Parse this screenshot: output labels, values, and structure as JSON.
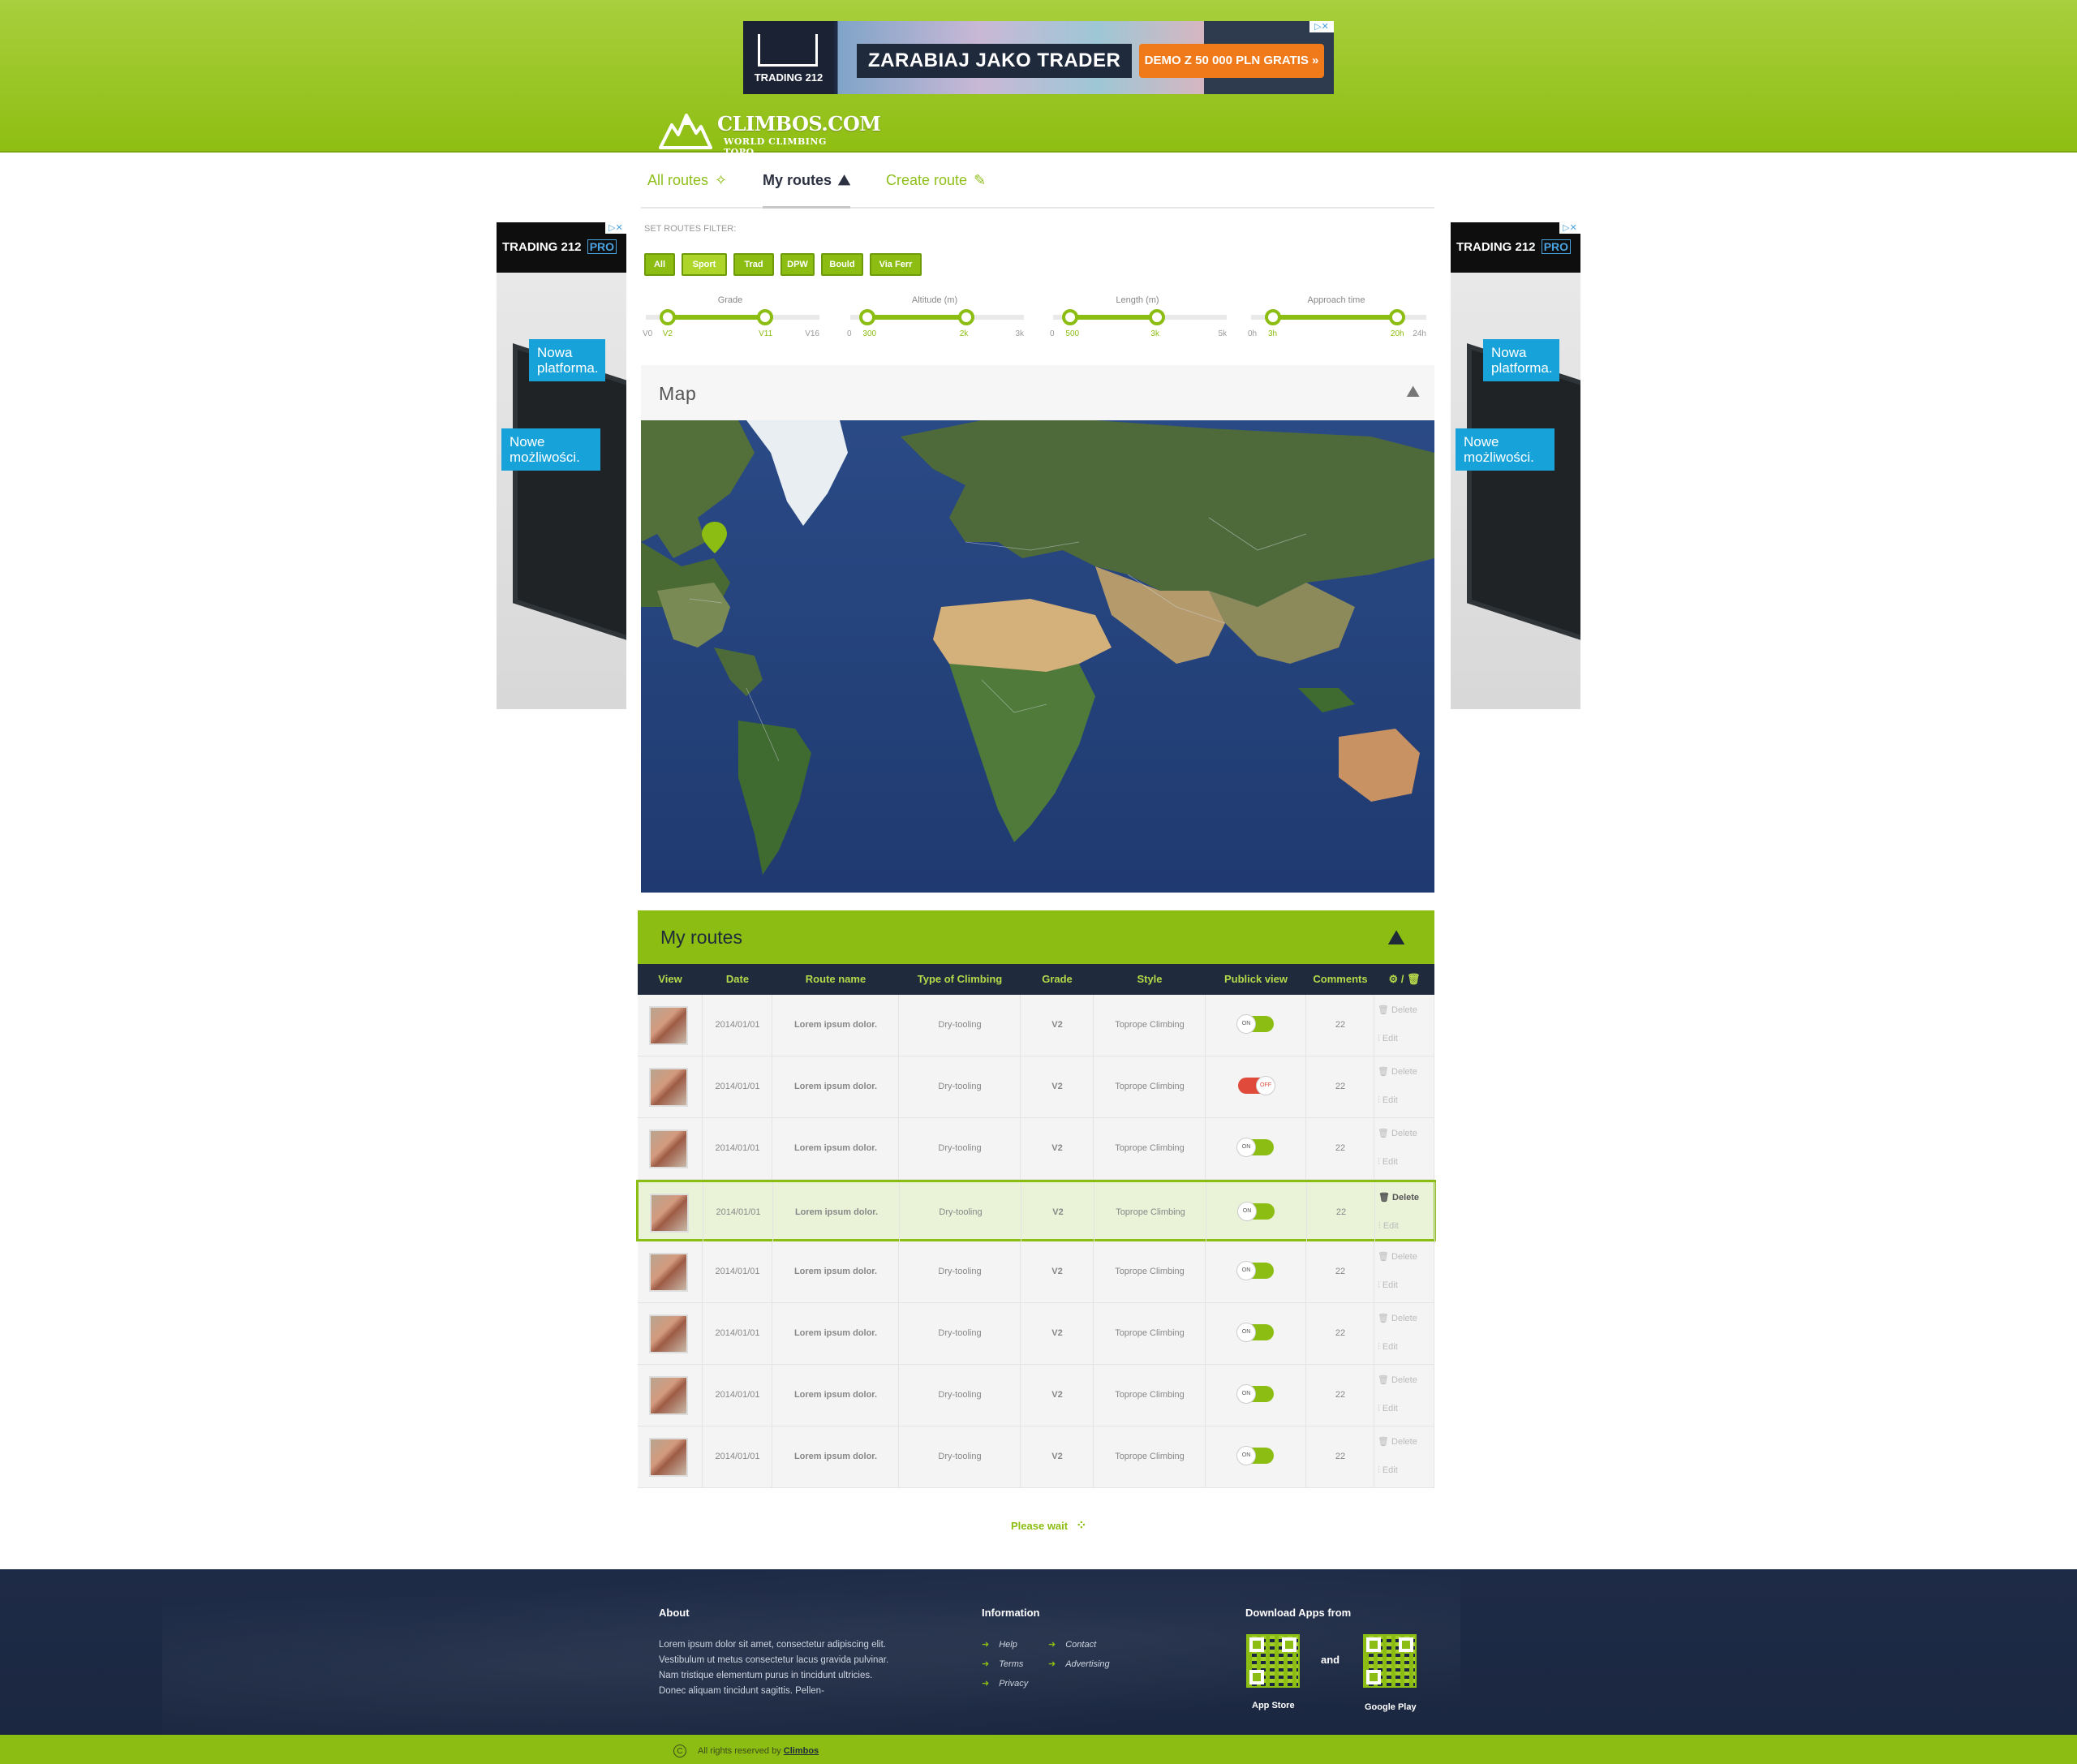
{
  "top_ad": {
    "brand": "TRADING 212",
    "headline": "ZARABIAJ JAKO TRADER",
    "cta": "DEMO Z 50 000 PLN GRATIS »",
    "close": "▷✕"
  },
  "logo": {
    "name": "CLIMBOS.COM",
    "tagline": "WORLD CLIMBING TOPO"
  },
  "tabs": [
    {
      "label": "All routes",
      "icon": "compass-icon",
      "glyph": "✧"
    },
    {
      "label": "My routes",
      "icon": "climber-icon",
      "glyph": "⛰"
    },
    {
      "label": "Create route",
      "icon": "add-route-icon",
      "glyph": "✎"
    }
  ],
  "side_ad": {
    "brand": "TRADING 212",
    "pro": "PRO",
    "bubble1": "Nowa platforma.",
    "bubble2": "Nowe możliwości.",
    "close": "▷✕"
  },
  "filter": {
    "title": "SET ROUTES FILTER:",
    "buttons": [
      "All",
      "Sport",
      "Trad",
      "DPW",
      "Bould",
      "Via Ferr"
    ],
    "active": "Sport",
    "sliders": [
      {
        "title": "Grade",
        "min": "V0",
        "low": "V2",
        "high": "V11",
        "max": "V16",
        "low_frac": 0.125,
        "high_frac": 0.6875
      },
      {
        "title": "Altitude (m)",
        "min": "0",
        "low": "300",
        "high": "2k",
        "max": "3k",
        "low_frac": 0.1,
        "high_frac": 0.667
      },
      {
        "title": "Length (m)",
        "min": "0",
        "low": "500",
        "high": "3k",
        "max": "5k",
        "low_frac": 0.1,
        "high_frac": 0.6
      },
      {
        "title": "Approach time",
        "min": "0h",
        "low": "3h",
        "high": "20h",
        "max": "24h",
        "low_frac": 0.125,
        "high_frac": 0.833
      }
    ]
  },
  "map": {
    "title": "Map",
    "icon": "map-icon"
  },
  "routes": {
    "title": "My routes",
    "columns": [
      "View",
      "Date",
      "Route name",
      "Type of Climbing",
      "Grade",
      "Style",
      "Publick view",
      "Comments",
      "⚙ / 🗑"
    ],
    "rows": [
      {
        "date": "2014/01/01",
        "name": "Lorem ipsum dolor.",
        "type": "Dry-tooling",
        "grade": "V2",
        "style": "Toprope Climbing",
        "public": "ON",
        "comments": "22",
        "delete": "Delete",
        "edit": "Edit"
      },
      {
        "date": "2014/01/01",
        "name": "Lorem ipsum dolor.",
        "type": "Dry-tooling",
        "grade": "V2",
        "style": "Toprope Climbing",
        "public": "OFF",
        "comments": "22",
        "delete": "Delete",
        "edit": "Edit"
      },
      {
        "date": "2014/01/01",
        "name": "Lorem ipsum dolor.",
        "type": "Dry-tooling",
        "grade": "V2",
        "style": "Toprope Climbing",
        "public": "ON",
        "comments": "22",
        "delete": "Delete",
        "edit": "Edit"
      },
      {
        "date": "2014/01/01",
        "name": "Lorem ipsum dolor.",
        "type": "Dry-tooling",
        "grade": "V2",
        "style": "Toprope Climbing",
        "public": "ON",
        "comments": "22",
        "delete": "Delete",
        "edit": "Edit"
      },
      {
        "date": "2014/01/01",
        "name": "Lorem ipsum dolor.",
        "type": "Dry-tooling",
        "grade": "V2",
        "style": "Toprope Climbing",
        "public": "ON",
        "comments": "22",
        "delete": "Delete",
        "edit": "Edit"
      },
      {
        "date": "2014/01/01",
        "name": "Lorem ipsum dolor.",
        "type": "Dry-tooling",
        "grade": "V2",
        "style": "Toprope Climbing",
        "public": "ON",
        "comments": "22",
        "delete": "Delete",
        "edit": "Edit"
      },
      {
        "date": "2014/01/01",
        "name": "Lorem ipsum dolor.",
        "type": "Dry-tooling",
        "grade": "V2",
        "style": "Toprope Climbing",
        "public": "ON",
        "comments": "22",
        "delete": "Delete",
        "edit": "Edit"
      },
      {
        "date": "2014/01/01",
        "name": "Lorem ipsum dolor.",
        "type": "Dry-tooling",
        "grade": "V2",
        "style": "Toprope Climbing",
        "public": "ON",
        "comments": "22",
        "delete": "Delete",
        "edit": "Edit"
      }
    ],
    "selected_row": 3
  },
  "loading": {
    "text": "Please wait"
  },
  "footer": {
    "about_title": "About",
    "about_text": "Lorem ipsum dolor sit amet, consectetur adipiscing elit. Vestibulum ut metus consectetur lacus gravida pulvinar. Nam tristique elementum purus in tincidunt ultricies. Donec aliquam tincidunt sagittis. Pellen-",
    "info_title": "Information",
    "links": [
      "Help",
      "Contact",
      "Terms",
      "Advertising",
      "Privacy"
    ],
    "apps_title": "Download Apps from",
    "and": "and",
    "app_store": "App Store",
    "google_play": "Google Play",
    "copyright": "All rights reserved by",
    "brand": "Climbos",
    "copyright_symbol": "C"
  },
  "colors": {
    "accent": "#8cbd12",
    "header": "#a8cf3d",
    "navy": "#1f2a3c",
    "off": "#e04a3a"
  }
}
